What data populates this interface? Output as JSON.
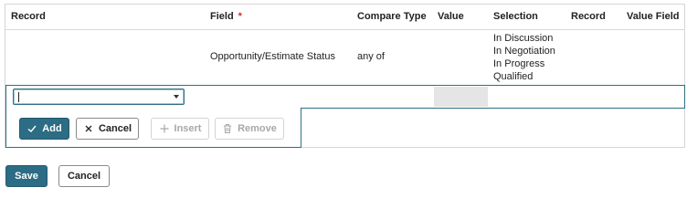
{
  "grid": {
    "columns": [
      {
        "key": "record",
        "label": "Record",
        "required": false
      },
      {
        "key": "field",
        "label": "Field",
        "required": true
      },
      {
        "key": "compare_type",
        "label": "Compare Type",
        "required": false
      },
      {
        "key": "value",
        "label": "Value",
        "required": false
      },
      {
        "key": "selection",
        "label": "Selection",
        "required": false
      },
      {
        "key": "record2",
        "label": "Record",
        "required": false
      },
      {
        "key": "value_field",
        "label": "Value Field",
        "required": false
      }
    ],
    "required_marker": "*",
    "rows": [
      {
        "record": "",
        "field": "Opportunity/Estimate Status",
        "compare_type": "any of",
        "value": "",
        "selection": [
          "In Discussion",
          "In Negotiation",
          "In Progress",
          "Qualified"
        ],
        "record2": "",
        "value_field": ""
      }
    ],
    "edit_row": {
      "record_select_value": ""
    }
  },
  "row_actions": {
    "add_label": "Add",
    "cancel_label": "Cancel",
    "insert_label": "Insert",
    "remove_label": "Remove"
  },
  "form_actions": {
    "save_label": "Save",
    "cancel_label": "Cancel"
  },
  "colors": {
    "primary": "#2c6c84",
    "required": "#c0392b",
    "disabled_text": "#a8a8a8"
  },
  "icons": {
    "add": "check-icon",
    "cancel": "x-icon",
    "insert": "plus-icon",
    "remove": "trash-icon",
    "dropdown": "chevron-down-icon"
  }
}
